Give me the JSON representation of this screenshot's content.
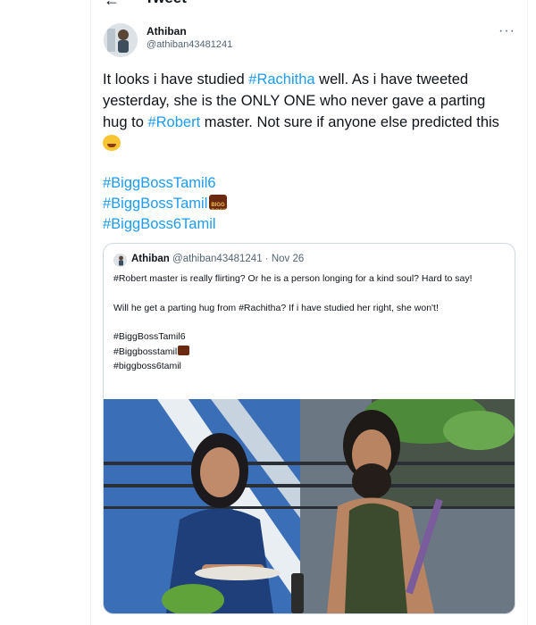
{
  "header": {
    "title": "Tweet"
  },
  "tweet": {
    "author_name": "Athiban",
    "author_handle": "@athiban43481241",
    "text": {
      "p1": "It looks i have studied ",
      "tag1": "#Rachitha",
      "p2": " well. As i have tweeted yesterday, she is the ONLY ONE who never gave a parting hug to ",
      "tag2": "#Robert",
      "p3": " master. Not sure if anyone else predicted this"
    },
    "hashtags": [
      "#BiggBossTamil6",
      "#BiggBossTamil",
      "#BiggBoss6Tamil"
    ]
  },
  "quoted_tweet": {
    "author_name": "Athiban",
    "author_handle": "@athiban43481241",
    "date": "· Nov 26",
    "line1": "#Robert master is really flirting? Or he is a person longing for a kind soul? Hard to say!",
    "line2": "Will he get a parting hug from #Rachitha? If i have studied her right, she won't!",
    "tags": [
      "#BiggBossTamil6",
      "#Biggbosstamil",
      "#biggboss6tamil"
    ]
  }
}
